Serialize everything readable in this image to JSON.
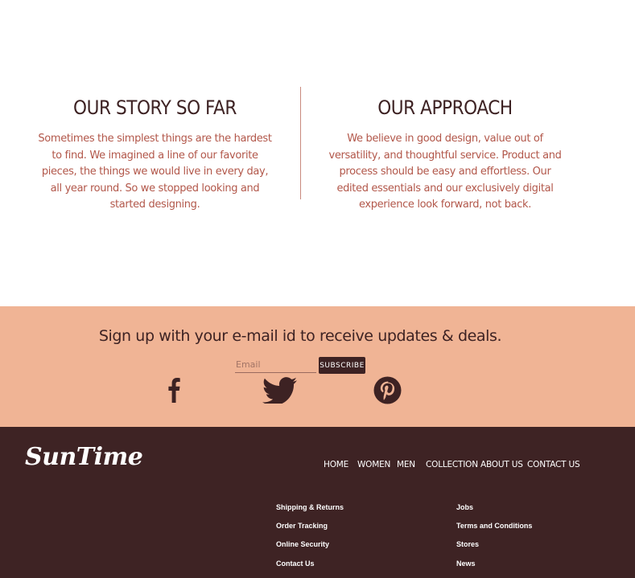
{
  "story": {
    "left": {
      "title": "OUR STORY SO FAR",
      "text": "Sometimes the simplest things are the hardest to find. We imagined a line of our favorite pieces, the things we would live in every day, all year round. So we stopped looking and started designing."
    },
    "right": {
      "title": "OUR APPROACH",
      "text": "We believe in good design, value out of versatility, and thoughtful service. Product and process should be easy and effortless. Our edited essentials and our exclusively digital experience look forward, not back."
    }
  },
  "newsletter": {
    "title": "Sign up with your e-mail id to receive updates & deals.",
    "email_placeholder": "Email",
    "email_value": "",
    "subscribe_label": "SUBSCRIBE",
    "social": [
      "facebook-icon",
      "twitter-icon",
      "pinterest-icon"
    ]
  },
  "footer": {
    "logo": "SunTime",
    "nav": [
      "HOME",
      "WOMEN",
      "MEN",
      "COLLECTION",
      "ABOUT US",
      "CONTACT US"
    ],
    "links_left": [
      "Shipping & Returns",
      "Order Tracking",
      "Online Security",
      "Contact Us"
    ],
    "links_right": [
      "Jobs",
      "Terms and Conditions",
      "Stores",
      "News"
    ]
  },
  "colors": {
    "dark_brown": "#3e2324",
    "peach": "#f0b495",
    "terracotta": "#b2574a",
    "white": "#ffffff"
  }
}
